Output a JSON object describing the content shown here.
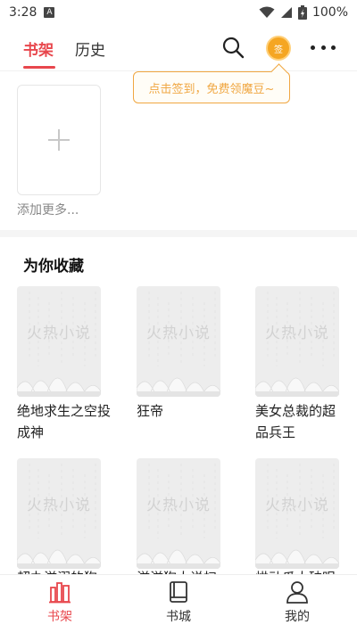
{
  "status_bar": {
    "time": "3:28",
    "notif_letter": "A",
    "battery": "100%"
  },
  "top_nav": {
    "tabs": [
      {
        "label": "书架",
        "active": true
      },
      {
        "label": "历史",
        "active": false
      }
    ],
    "sign_badge": "签"
  },
  "tooltip": {
    "text": "点击签到，免费领魔豆~"
  },
  "shelf": {
    "add_label": "添加更多..."
  },
  "recommend": {
    "title": "为你收藏",
    "cover_text": "火热小说",
    "books": [
      {
        "title": "绝地求生之空投成神"
      },
      {
        "title": "狂帝"
      },
      {
        "title": "美女总裁的超品兵王"
      },
      {
        "title": "超办滋溺的狗"
      },
      {
        "title": "滋滋狗太说扫"
      },
      {
        "title": "烘动瓜太破眼"
      }
    ]
  },
  "bottom_nav": {
    "items": [
      {
        "label": "书架",
        "active": true
      },
      {
        "label": "书城",
        "active": false
      },
      {
        "label": "我的",
        "active": false
      }
    ]
  },
  "colors": {
    "accent": "#e8474d",
    "tooltip": "#f0a742",
    "sign": "#f5a623"
  }
}
